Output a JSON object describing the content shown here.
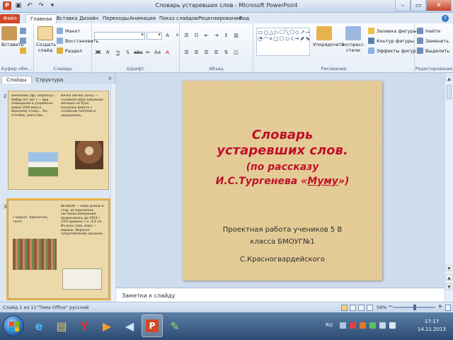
{
  "window": {
    "title": "Словарь устаревших слов - Microsoft PowerPoint",
    "logo_letter": "P"
  },
  "ribbon_tabs": [
    "Файл",
    "Главная",
    "Вставка",
    "Дизайн",
    "Переходы",
    "Анимация",
    "Показ слайдов",
    "Рецензирование",
    "Вид"
  ],
  "ribbon": {
    "clipboard": {
      "paste": "Вставить",
      "cut": "Вырезать",
      "copy": "Копировать",
      "painter": "Формат",
      "label": "Буфер обм..."
    },
    "slides": {
      "new_slide": "Создать\nслайд",
      "layout": "Макет",
      "reset": "Восстановить",
      "section": "Раздел",
      "label": "Слайды"
    },
    "font": {
      "label": "Шрифт"
    },
    "paragraph": {
      "label": "Абзац"
    },
    "drawing": {
      "arrange": "Упорядочить",
      "quick_styles": "Экспресс-стили",
      "shape_fill": "Заливка фигуры",
      "shape_outline": "Контур фигуры",
      "shape_effects": "Эффекты фигур",
      "label": "Рисование"
    },
    "editing": {
      "find": "Найти",
      "replace": "Заменить",
      "select": "Выделить",
      "label": "Редактирование"
    }
  },
  "panel": {
    "tab_slides": "Слайды",
    "tab_outline": "Структура",
    "close": "×"
  },
  "thumbnails": [
    {
      "number": "2",
      "left_text": "Ампиловы (фр. ampilovy)... Амбар (от лат.) — вид помещения в усадебных домах XVIII века к верхнему этажу... Кн. столбов, уместлин.",
      "right_text": "Кичка (кичка, кичь) — головной убор замужних женщин на Руси. Носилась вместе с головным платком и украшалась.",
      "photo1_color": "#6b8f4a",
      "photo2_color": "#8a5a3a"
    },
    {
      "number": "3",
      "left_text": "• Бархат, бархатное, тонет",
      "right_text": "ВЕРШОК — мера длины в стар. исторических системах измерения, применялась до 1924 г. 1/16 аршина, т.е. 4,4 см. Из всех слов, мера — вершок. Верхнее сопротивление, высокое...",
      "photo1_color": "#8e5b3c",
      "photo2_color": "#d9d2c2"
    }
  ],
  "slide": {
    "title_line1": "Словарь",
    "title_line2": "устаревших слов.",
    "sub_line1": "(по рассказу",
    "sub_line2_pre": "И.С.Тургенева «",
    "sub_line2_link": "Муму",
    "sub_line2_post": "»)",
    "body_line1": "Проектная работа учеников 5 В",
    "body_line2": "класса БМОУГ№1",
    "body_line3": "С.Красногвардейского"
  },
  "notes": {
    "placeholder": "Заметки к слайду"
  },
  "status": {
    "slide_info": "Слайд 1 из 11",
    "theme": "\"Тема Office\"",
    "language": "русский",
    "zoom": "59%"
  },
  "taskbar": {
    "tray_lang": "RU",
    "time": "17:17",
    "date": "14.11.2013",
    "colors": {
      "start": "#1f5fa8",
      "active_app": "#d24726"
    }
  }
}
